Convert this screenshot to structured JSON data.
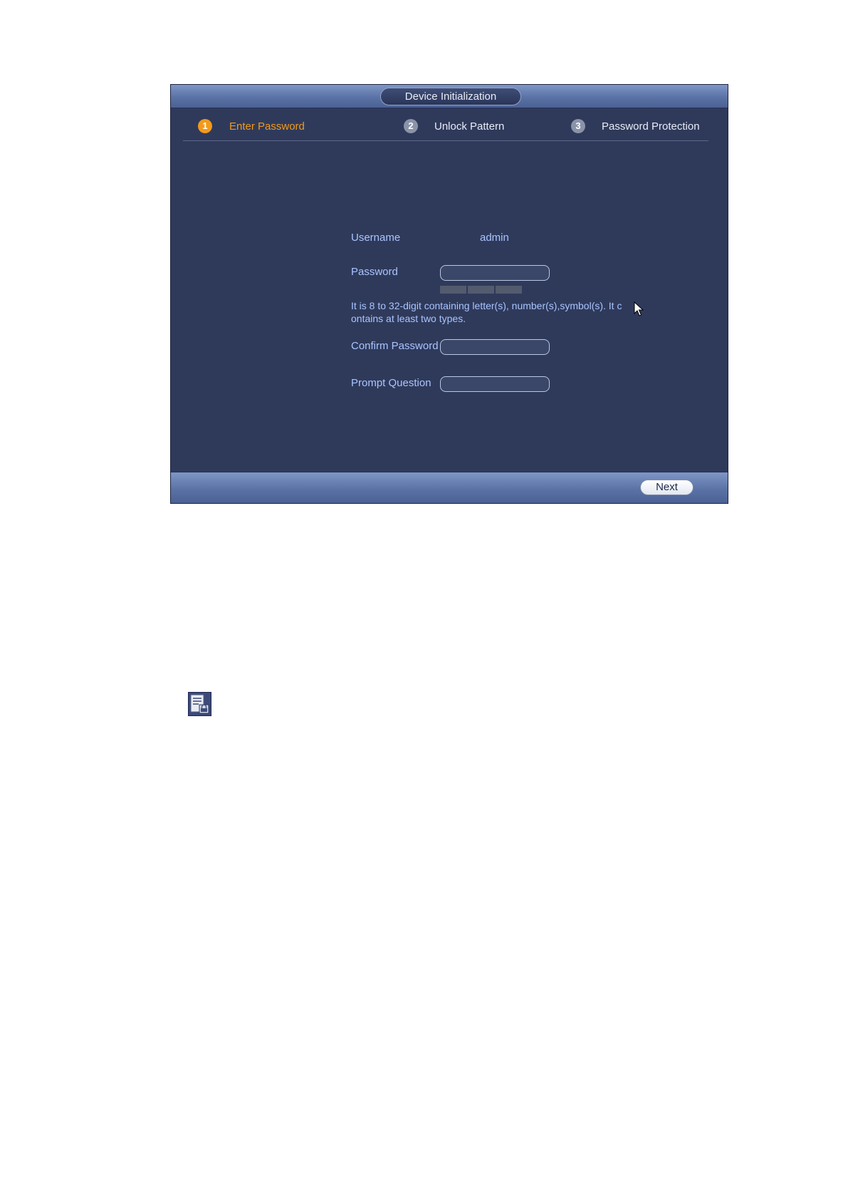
{
  "dialog": {
    "title": "Device Initialization"
  },
  "steps": [
    {
      "number": "1",
      "label": "Enter Password",
      "active": true
    },
    {
      "number": "2",
      "label": "Unlock Pattern",
      "active": false
    },
    {
      "number": "3",
      "label": "Password Protection",
      "active": false
    }
  ],
  "form": {
    "username_label": "Username",
    "username_value": "admin",
    "password_label": "Password",
    "password_value": "",
    "password_hint": "It is 8 to 32-digit containing letter(s), number(s),symbol(s). It contains at least two types.",
    "confirm_label": "Confirm Password",
    "confirm_value": "",
    "prompt_label": "Prompt Question",
    "prompt_value": "",
    "strength_segments": 3
  },
  "footer": {
    "next_label": "Next"
  },
  "icons": {
    "cursor": "mouse-cursor-icon",
    "note": "note-icon"
  },
  "colors": {
    "accent": "#f29a1b",
    "label": "#a9c4ff",
    "panel": "#2f3a5b",
    "bar": "#5a72a5"
  }
}
